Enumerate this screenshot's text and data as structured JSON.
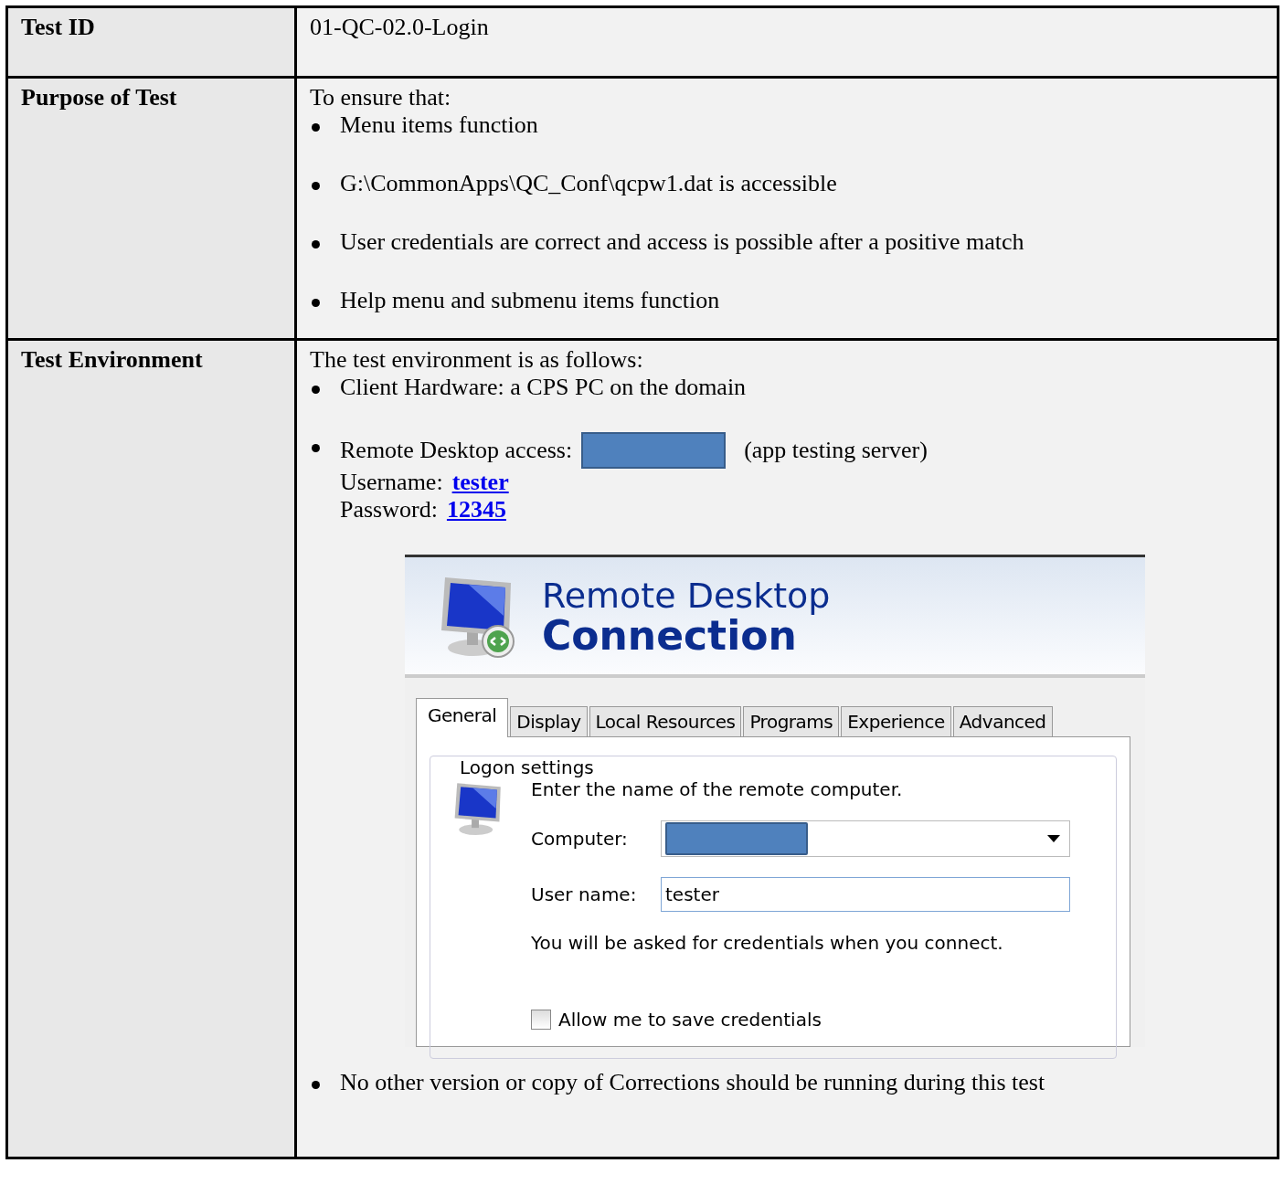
{
  "rows": [
    {
      "kind": "text",
      "label": "Test ID",
      "value": "01-QC-02.0-Login"
    },
    {
      "kind": "bullets",
      "label": "Purpose of Test",
      "intro": "To ensure that:",
      "bullets": [
        "Menu items function",
        "G:\\CommonApps\\QC_Conf\\qcpw1.dat is accessible",
        "User credentials are correct and access is possible after a positive match",
        "Help menu and submenu items function"
      ]
    },
    {
      "kind": "environment",
      "label": "Test Environment",
      "intro": "The test environment is as follows:",
      "hardware": "Client Hardware: a CPS PC on the domain",
      "remote_label": "Remote Desktop access:",
      "remote_note": "(app testing server)",
      "username_label": "Username:",
      "username": "tester",
      "password_label": "Password:",
      "password": "12345",
      "dialog": {
        "title_line1": "Remote Desktop",
        "title_line2": "Connection",
        "tabs": [
          {
            "label": "General",
            "selected": true
          },
          {
            "label": "Display",
            "selected": false
          },
          {
            "label": "Local Resources",
            "selected": false
          },
          {
            "label": "Programs",
            "selected": false
          },
          {
            "label": "Experience",
            "selected": false
          },
          {
            "label": "Advanced",
            "selected": false
          }
        ],
        "group": "Logon settings",
        "prompt": "Enter the name of the remote computer.",
        "computer_label": "Computer:",
        "user_label": "User name:",
        "user_value": "tester",
        "note": "You will be asked for credentials when you connect.",
        "save_label": "Allow me to save credentials",
        "save_checked": false
      },
      "last": "No other version or copy of Corrections should be running during this test"
    }
  ]
}
